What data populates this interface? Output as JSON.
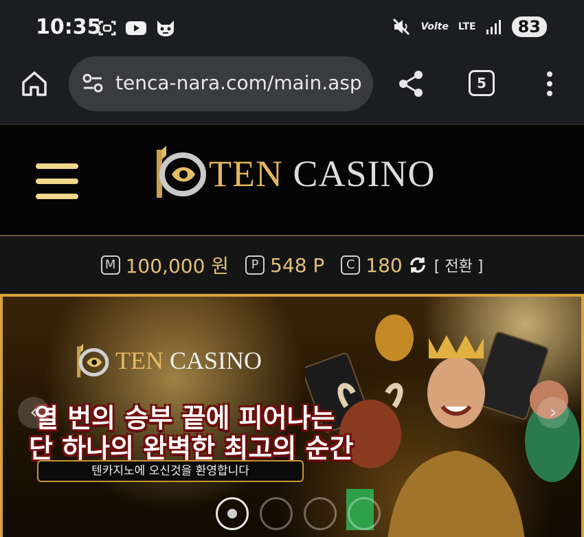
{
  "status_bar": {
    "time": "10:35",
    "left_icons": [
      "screenshot-icon",
      "youtube-icon",
      "cat-mask-icon"
    ],
    "right_icons": [
      "mute-icon",
      "volte-icon",
      "lte-icon",
      "signal-icon"
    ],
    "volte_label": "Volte",
    "lte_label": "LTE",
    "battery": "83"
  },
  "browser": {
    "url": "tenca-nara.com/main.asp",
    "tab_count": "5"
  },
  "site": {
    "logo_ten": "TEN",
    "logo_casino": "CASINO",
    "colors": {
      "gold": "#e4b75c",
      "accent_border": "#d9a43a"
    }
  },
  "points": {
    "money_badge": "M",
    "money": "100,000 원",
    "point_badge": "P",
    "point": "548 P",
    "coin_badge": "C",
    "coin": "180",
    "swap_label": "[ 전환 ]"
  },
  "banner": {
    "logo_ten": "TEN",
    "logo_casino": "CASINO",
    "headline_1": "열 번의 승부 끝에 피어나는",
    "headline_2": "단 하나의 완벽한 최고의 순간",
    "welcome": "텐카지노에 오신것을 환영합니다",
    "prev_arrow": "‹",
    "next_arrow": "›",
    "slide_count": 4,
    "active_slide": 1
  }
}
